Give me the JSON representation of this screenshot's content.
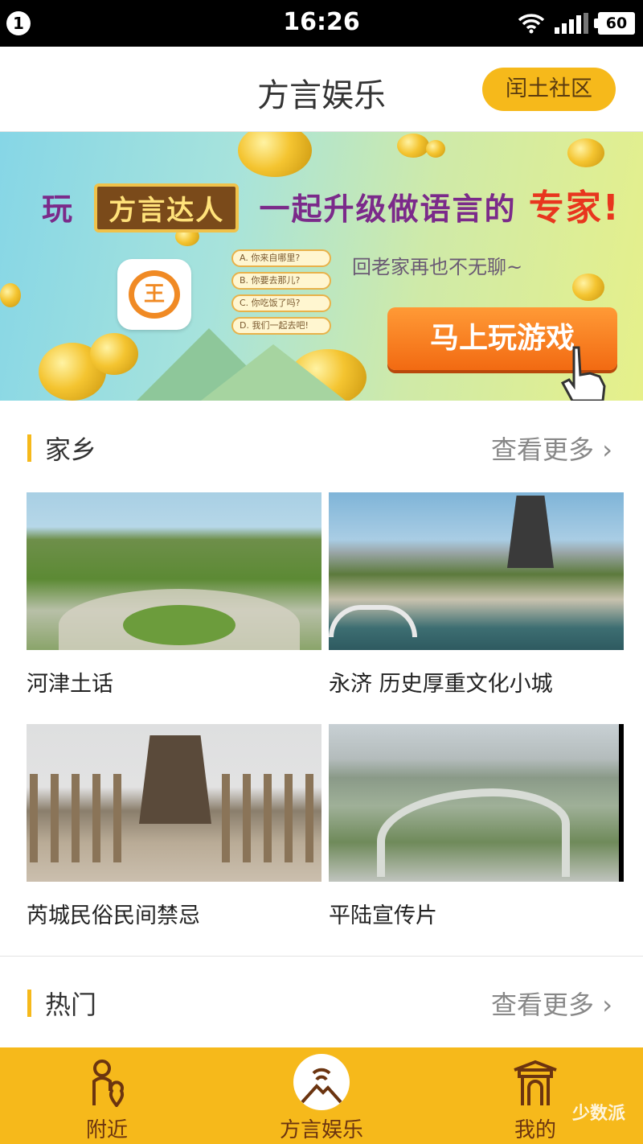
{
  "status_bar": {
    "notification_count": "1",
    "time": "16:26",
    "battery": "60"
  },
  "header": {
    "title": "方言娱乐",
    "community_button": "闰土社区"
  },
  "banner": {
    "lead_text": "玩",
    "badge_text": "方言达人",
    "middle_text": "一起升级做语言的",
    "highlight_text": "专家!",
    "tagline": "回老家再也不无聊~",
    "options": [
      "A. 你来自哪里?",
      "B. 你要去那儿?",
      "C. 你吃饭了吗?",
      "D. 我们一起去吧!"
    ],
    "play_button": "马上玩游戏",
    "app_icon_glyph": "王"
  },
  "sections": [
    {
      "title": "家乡",
      "more": "查看更多",
      "cards": [
        {
          "label": "河津土话"
        },
        {
          "label": "永济 历史厚重文化小城"
        },
        {
          "label": "芮城民俗民间禁忌"
        },
        {
          "label": "平陆宣传片"
        }
      ]
    },
    {
      "title": "热门",
      "more": "查看更多"
    }
  ],
  "tabbar": {
    "items": [
      {
        "label": "附近",
        "icon": "location-person-icon",
        "active": false
      },
      {
        "label": "方言娱乐",
        "icon": "mountain-signal-icon",
        "active": true
      },
      {
        "label": "我的",
        "icon": "gate-icon",
        "active": false
      }
    ]
  },
  "watermark": "少数派",
  "colors": {
    "accent": "#f6b91b",
    "tab_text": "#6b3410",
    "more_text": "#888888"
  }
}
